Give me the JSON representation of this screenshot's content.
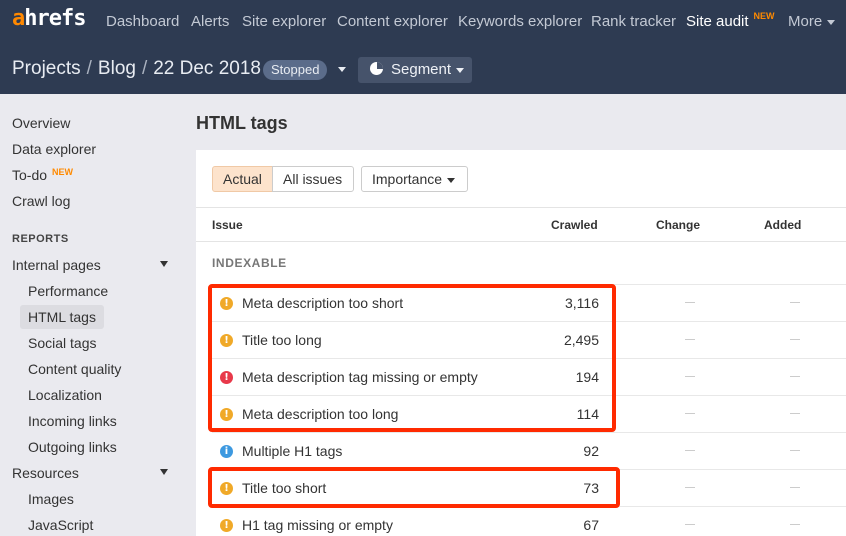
{
  "header": {
    "logo": {
      "first": "a",
      "rest": "hrefs"
    },
    "nav": [
      {
        "label": "Dashboard",
        "active": false
      },
      {
        "label": "Alerts",
        "active": false
      },
      {
        "label": "Site explorer",
        "active": false
      },
      {
        "label": "Content explorer",
        "active": false
      },
      {
        "label": "Keywords explorer",
        "active": false
      },
      {
        "label": "Rank tracker",
        "active": false
      },
      {
        "label": "Site audit",
        "active": true,
        "badge": "NEW"
      },
      {
        "label": "More",
        "active": false
      }
    ],
    "breadcrumb": [
      "Projects",
      "Blog",
      "22 Dec 2018"
    ],
    "breadcrumb_separator": "/",
    "status_badge": "Stopped",
    "segment_button": "Segment"
  },
  "sidebar": {
    "top_items": [
      {
        "label": "Overview"
      },
      {
        "label": "Data explorer"
      },
      {
        "label": "To-do",
        "badge": "NEW"
      },
      {
        "label": "Crawl log"
      }
    ],
    "reports_heading": "REPORTS",
    "internal_pages": {
      "label": "Internal pages",
      "children": [
        "Performance",
        "HTML tags",
        "Social tags",
        "Content quality",
        "Localization",
        "Incoming links",
        "Outgoing links"
      ],
      "selected": "HTML tags"
    },
    "resources": {
      "label": "Resources",
      "children": [
        "Images",
        "JavaScript"
      ]
    }
  },
  "main": {
    "title": "HTML tags",
    "filters": {
      "actual": "Actual",
      "all_issues": "All issues",
      "importance": "Importance",
      "selected": "Actual"
    },
    "columns": {
      "issue": "Issue",
      "crawled": "Crawled",
      "change": "Change",
      "added": "Added"
    },
    "group": "INDEXABLE",
    "rows": [
      {
        "severity": "warning",
        "icon": "!",
        "issue": "Meta description too short",
        "crawled": "3,116",
        "change": "—",
        "added": "—"
      },
      {
        "severity": "warning",
        "icon": "!",
        "issue": "Title too long",
        "crawled": "2,495",
        "change": "—",
        "added": "—"
      },
      {
        "severity": "error",
        "icon": "!",
        "issue": "Meta description tag missing or empty",
        "crawled": "194",
        "change": "—",
        "added": "—"
      },
      {
        "severity": "warning",
        "icon": "!",
        "issue": "Meta description too long",
        "crawled": "114",
        "change": "—",
        "added": "—"
      },
      {
        "severity": "notice",
        "icon": "i",
        "issue": "Multiple H1 tags",
        "crawled": "92",
        "change": "—",
        "added": "—"
      },
      {
        "severity": "warning",
        "icon": "!",
        "issue": "Title too short",
        "crawled": "73",
        "change": "—",
        "added": "—"
      },
      {
        "severity": "warning",
        "icon": "!",
        "issue": "H1 tag missing or empty",
        "crawled": "67",
        "change": "—",
        "added": "—"
      }
    ]
  },
  "colors": {
    "header_bg": "#2e3b52",
    "brand_orange": "#ff8800",
    "warning": "#f0a928",
    "error": "#e8394a",
    "notice": "#3d99e0",
    "highlight": "#ff2a00"
  }
}
